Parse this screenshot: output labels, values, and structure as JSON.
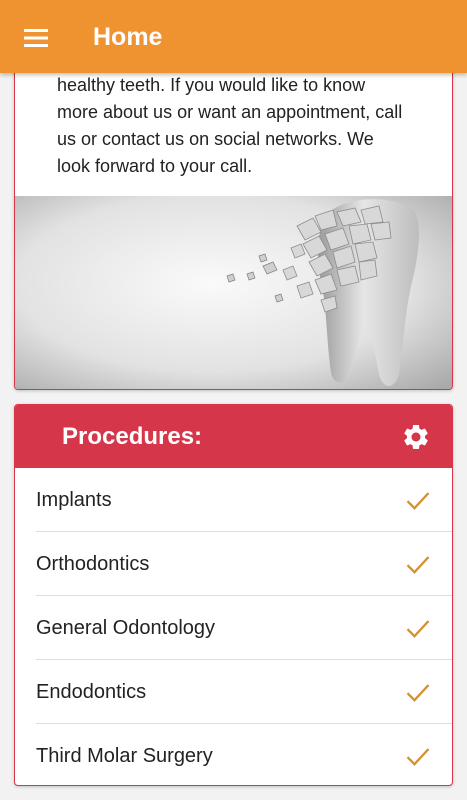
{
  "appbar": {
    "title": "Home",
    "menu_icon": "hamburger-menu-icon",
    "color": "#ef9331"
  },
  "intro": {
    "text": "healthy teeth. If you would like to know\nmore about us or want an appointment, call\nus or contact us on social networks. We\nlook forward to your call."
  },
  "image": {
    "description_icon": "shattered-tooth-image"
  },
  "procedures": {
    "title": "Procedures:",
    "header_color": "#d5364a",
    "settings_icon": "gear-icon",
    "check_icon": "checkmark-icon",
    "check_color": "#d4912f",
    "items": [
      {
        "label": "Implants"
      },
      {
        "label": "Orthodontics"
      },
      {
        "label": "General Odontology"
      },
      {
        "label": "Endodontics"
      },
      {
        "label": "Third Molar Surgery"
      }
    ]
  }
}
